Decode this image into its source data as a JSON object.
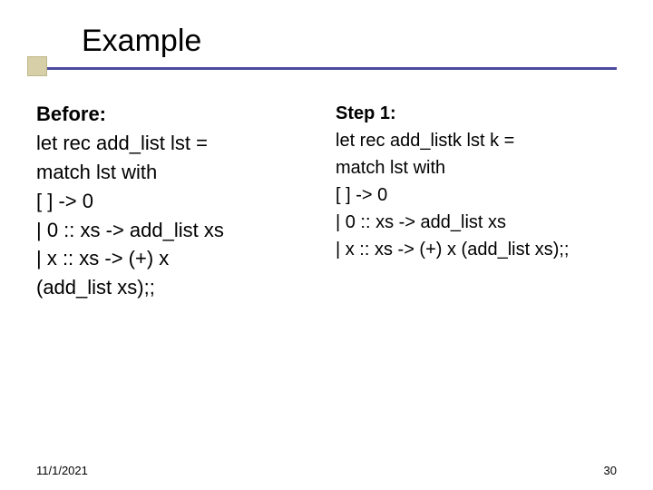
{
  "title": "Example",
  "left": {
    "heading": "Before:",
    "lines": [
      "let rec add_list lst =",
      "match lst with",
      "  [ ] -> 0",
      "| 0 :: xs -> add_list xs",
      "| x :: xs -> (+) x",
      "   (add_list xs);;"
    ]
  },
  "right": {
    "heading": "Step 1:",
    "lines": [
      "let rec add_listk lst k =",
      "match lst with",
      "  [ ] -> 0",
      "| 0 :: xs -> add_list xs",
      "| x :: xs -> (+) x (add_list xs);;"
    ]
  },
  "footer": {
    "date": "11/1/2021",
    "page": "30"
  }
}
